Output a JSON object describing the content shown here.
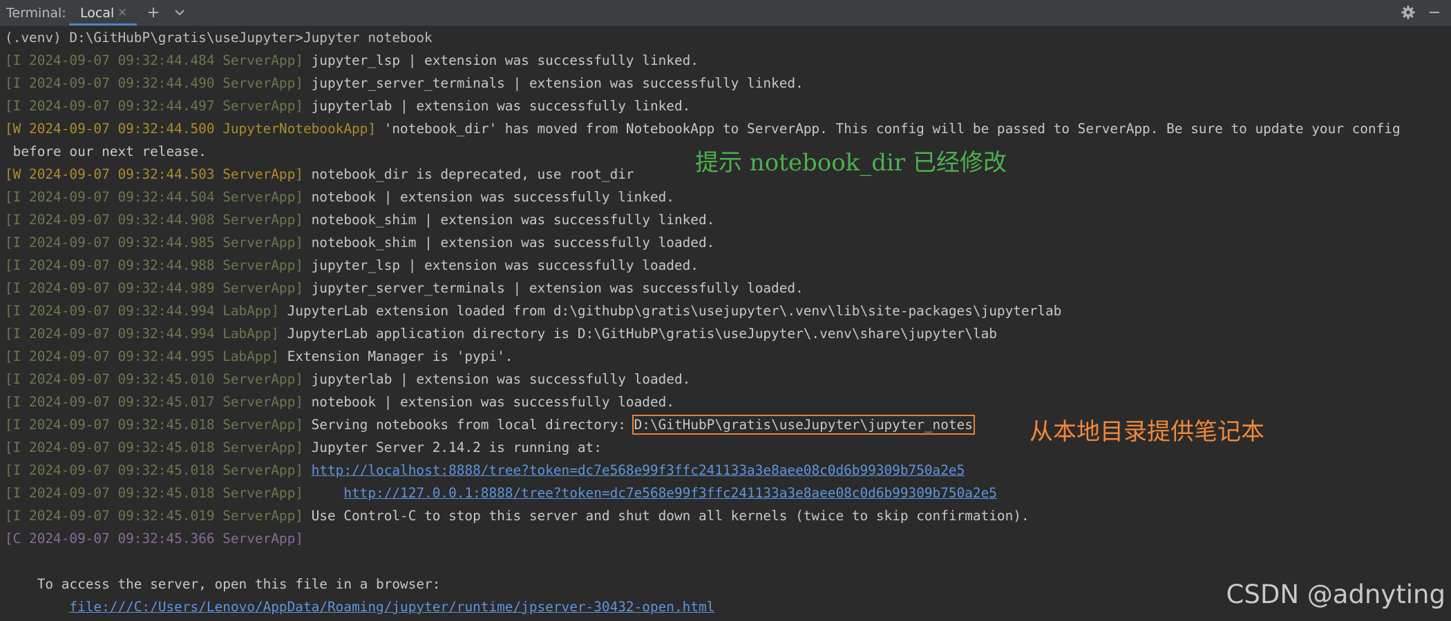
{
  "toolwindow": {
    "title": "Terminal:",
    "tabs": [
      {
        "label": "Local",
        "close": "×"
      }
    ],
    "actions": {
      "add": "plus-icon",
      "dropdown": "chevron-down-icon",
      "settings": "gear-icon",
      "minimize": "minimize-icon"
    }
  },
  "terminal": {
    "prompt": "(.venv) D:\\GitHubP\\gratis\\useJupyter>Jupyter notebook",
    "lines": [
      {
        "prefix": "[I 2024-09-07 09:32:44.484 ServerApp]",
        "message": " jupyter_lsp | extension was successfully linked."
      },
      {
        "prefix": "[I 2024-09-07 09:32:44.490 ServerApp]",
        "message": " jupyter_server_terminals | extension was successfully linked."
      },
      {
        "prefix": "[I 2024-09-07 09:32:44.497 ServerApp]",
        "message": " jupyterlab | extension was successfully linked."
      },
      {
        "prefix": "[W 2024-09-07 09:32:44.500 JupyterNotebookApp]",
        "message": " 'notebook_dir' has moved from NotebookApp to ServerApp. This config will be passed to ServerApp. Be sure to update your config"
      },
      {
        "prefix": "",
        "message": " before our next release."
      },
      {
        "prefix": "[W 2024-09-07 09:32:44.503 ServerApp]",
        "message": " notebook_dir is deprecated, use root_dir"
      },
      {
        "prefix": "[I 2024-09-07 09:32:44.504 ServerApp]",
        "message": " notebook | extension was successfully linked."
      },
      {
        "prefix": "[I 2024-09-07 09:32:44.908 ServerApp]",
        "message": " notebook_shim | extension was successfully linked."
      },
      {
        "prefix": "[I 2024-09-07 09:32:44.985 ServerApp]",
        "message": " notebook_shim | extension was successfully loaded."
      },
      {
        "prefix": "[I 2024-09-07 09:32:44.988 ServerApp]",
        "message": " jupyter_lsp | extension was successfully loaded."
      },
      {
        "prefix": "[I 2024-09-07 09:32:44.989 ServerApp]",
        "message": " jupyter_server_terminals | extension was successfully loaded."
      },
      {
        "prefix": "[I 2024-09-07 09:32:44.994 LabApp]",
        "message": " JupyterLab extension loaded from d:\\githubp\\gratis\\usejupyter\\.venv\\lib\\site-packages\\jupyterlab"
      },
      {
        "prefix": "[I 2024-09-07 09:32:44.994 LabApp]",
        "message": " JupyterLab application directory is D:\\GitHubP\\gratis\\useJupyter\\.venv\\share\\jupyter\\lab"
      },
      {
        "prefix": "[I 2024-09-07 09:32:44.995 LabApp]",
        "message": " Extension Manager is 'pypi'."
      },
      {
        "prefix": "[I 2024-09-07 09:32:45.010 ServerApp]",
        "message": " jupyterlab | extension was successfully loaded."
      },
      {
        "prefix": "[I 2024-09-07 09:32:45.017 ServerApp]",
        "message": " notebook | extension was successfully loaded."
      },
      {
        "prefix": "[I 2024-09-07 09:32:45.018 ServerApp]",
        "message": " Serving notebooks from local directory: ",
        "boxed": "D:\\GitHubP\\gratis\\useJupyter\\jupyter_notes"
      },
      {
        "prefix": "[I 2024-09-07 09:32:45.018 ServerApp]",
        "message": " Jupyter Server 2.14.2 is running at:"
      },
      {
        "prefix": "[I 2024-09-07 09:32:45.018 ServerApp]",
        "message": " ",
        "link": "http://localhost:8888/tree?token=dc7e568e99f3ffc241133a3e8aee08c0d6b99309b750a2e5"
      },
      {
        "prefix": "[I 2024-09-07 09:32:45.018 ServerApp]",
        "message": "     ",
        "link": "http://127.0.0.1:8888/tree?token=dc7e568e99f3ffc241133a3e8aee08c0d6b99309b750a2e5"
      },
      {
        "prefix": "[I 2024-09-07 09:32:45.019 ServerApp]",
        "message": " Use Control-C to stop this server and shut down all kernels (twice to skip confirmation)."
      },
      {
        "prefix": "[C 2024-09-07 09:32:45.366 ServerApp]",
        "message": ""
      },
      {
        "prefix": "",
        "message": ""
      },
      {
        "prefix": "",
        "message": "    To access the server, open this file in a browser:"
      },
      {
        "prefix": "",
        "message": "        ",
        "link": "file:///C:/Users/Lenovo/AppData/Roaming/jupyter/runtime/jpserver-30432-open.html"
      }
    ]
  },
  "annotations": {
    "notebook_dir_note": "提示 notebook_dir 已经修改",
    "local_dir_note": "从本地目录提供笔记本"
  },
  "watermark": "CSDN @adnyting",
  "colors": {
    "background": "#2b2b2b",
    "prefix_info": "#687a4c",
    "prefix_warn": "#b08b2d",
    "prefix_critical": "#8b6a9a",
    "link": "#5e95df",
    "box": "#e3833a",
    "note_green": "#4cb050",
    "note_orange": "#f0883a"
  }
}
